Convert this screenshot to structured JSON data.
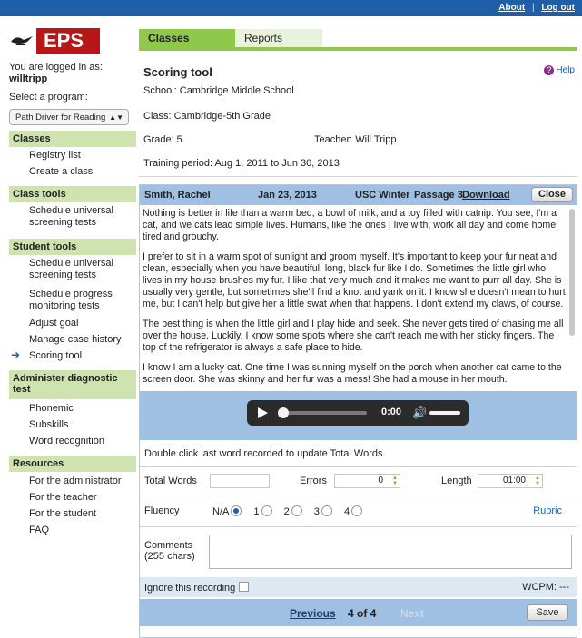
{
  "topnav": {
    "about": "About",
    "separator": "|",
    "logout": "Log out"
  },
  "brand": {
    "logo": "EPS"
  },
  "user": {
    "logged_in_as": "You are logged in as:",
    "username": "willtripp"
  },
  "program": {
    "label": "Select a program:",
    "selected": "Path Driver for Reading"
  },
  "sidebar": {
    "classes": {
      "header": "Classes",
      "items": [
        "Registry list",
        "Create a class"
      ]
    },
    "class_tools": {
      "header": "Class tools",
      "items": [
        "Schedule universal screening tests"
      ]
    },
    "student_tools": {
      "header": "Student tools",
      "items": [
        "Schedule universal screening tests",
        "Schedule progress monitoring tests",
        "Adjust goal",
        "Manage case history",
        "Scoring tool"
      ]
    },
    "administer": {
      "header": "Administer diagnostic test",
      "items": [
        "Phonemic",
        "Subskills",
        "Word recognition"
      ]
    },
    "resources": {
      "header": "Resources",
      "items": [
        "For the administrator",
        "For the teacher",
        "For the student",
        "FAQ"
      ]
    }
  },
  "tabs": {
    "active": "Classes",
    "inactive": "Reports"
  },
  "tool": {
    "title": "Scoring tool",
    "help": "Help",
    "school": "School:  Cambridge Middle School",
    "class": "Class:  Cambridge-5th Grade",
    "grade": "Grade:  5",
    "teacher": "Teacher:  Will Tripp",
    "training": "Training period:  Aug 1, 2011 to Jun 30, 2013"
  },
  "recording": {
    "student": "Smith, Rachel",
    "date": "Jan 23, 2013",
    "session": "USC Winter",
    "passage": "Passage 3",
    "download": "Download",
    "close": "Close",
    "paragraphs": [
      "Nothing is better in life than a warm bed, a bowl of milk, and a toy filled with catnip. You see, I'm a cat, and we cats lead simple lives. Humans, like the ones I live with, work all day and come home tired and grouchy.",
      "I prefer to sit in a warm spot of sunlight and groom myself. It's important to keep your fur neat and clean, especially when you have beautiful, long, black fur like I do. Sometimes the little girl who lives in my house brushes my fur. I like that very much and it makes me want to purr all day. She is usually very gentle, but sometimes she'll find a knot and yank on it. I know she doesn't mean to hurt me, but I can't help but give her a little swat when that happens. I don't extend my claws, of course.",
      "The best thing is when the little girl and I play hide and seek. She never gets tired of chasing me all over the house. Luckily, I know some spots where she can't reach me with her sticky fingers. The top of the refrigerator is always a safe place to hide.",
      "I know I am a lucky cat. One time I was sunning myself on the porch when another cat came to the screen door. She was skinny and her fur was a mess! She had a mouse in her mouth."
    ],
    "player_time": "0:00",
    "player_progress": 0
  },
  "scoring": {
    "instruction": "Double click last word recorded to update Total Words.",
    "total_words_label": "Total Words",
    "total_words_value": "",
    "errors_label": "Errors",
    "errors_value": "0",
    "length_label": "Length",
    "length_value": "01:00",
    "fluency_label": "Fluency",
    "fluency_options": [
      "N/A",
      "1",
      "2",
      "3",
      "4"
    ],
    "fluency_selected": "N/A",
    "rubric": "Rubric",
    "comments_label_1": "Comments",
    "comments_label_2": "(255 chars)",
    "ignore_label": "Ignore this recording",
    "wcpm": "WCPM: ---"
  },
  "pager": {
    "previous": "Previous",
    "position": "4  of  4",
    "next": "Next",
    "save": "Save"
  }
}
